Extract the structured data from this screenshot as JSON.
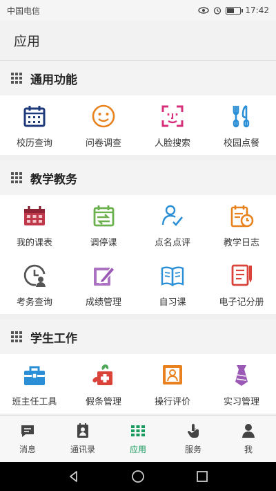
{
  "status_bar": {
    "carrier": "中国电信",
    "time": "17:42",
    "battery_level": 0.55
  },
  "app_bar": {
    "title": "应用"
  },
  "sections": [
    {
      "title": "通用功能",
      "items": [
        {
          "label": "校历查询",
          "icon": "calendar-icon"
        },
        {
          "label": "问卷调查",
          "icon": "smiley-icon"
        },
        {
          "label": "人脸搜索",
          "icon": "face-scan-icon"
        },
        {
          "label": "校园点餐",
          "icon": "fork-knife-icon"
        }
      ]
    },
    {
      "title": "教学教务",
      "items": [
        {
          "label": "我的课表",
          "icon": "timetable-icon"
        },
        {
          "label": "调停课",
          "icon": "calendar-swap-icon"
        },
        {
          "label": "点名点评",
          "icon": "person-check-icon"
        },
        {
          "label": "教学日志",
          "icon": "log-clock-icon"
        },
        {
          "label": "考务查询",
          "icon": "clock-person-icon"
        },
        {
          "label": "成绩管理",
          "icon": "edit-icon"
        },
        {
          "label": "自习课",
          "icon": "book-icon"
        },
        {
          "label": "电子记分册",
          "icon": "scorebook-icon"
        }
      ]
    },
    {
      "title": "学生工作",
      "items": [
        {
          "label": "班主任工具",
          "icon": "toolbox-icon"
        },
        {
          "label": "假条管理",
          "icon": "medical-icon"
        },
        {
          "label": "操行评价",
          "icon": "portrait-icon"
        },
        {
          "label": "实习管理",
          "icon": "tie-icon"
        }
      ]
    }
  ],
  "tabs": [
    {
      "label": "消息",
      "icon": "message-icon",
      "active": false
    },
    {
      "label": "通讯录",
      "icon": "contacts-icon",
      "active": false
    },
    {
      "label": "应用",
      "icon": "apps-grid-icon",
      "active": true
    },
    {
      "label": "服务",
      "icon": "touch-icon",
      "active": false
    },
    {
      "label": "我",
      "icon": "user-icon",
      "active": false
    }
  ],
  "colors": {
    "active_tab": "#1a9a5c",
    "navy": "#1f3a7a",
    "orange": "#e8821e",
    "magenta": "#d6307a",
    "teal": "#2a8fd6",
    "green": "#6ab04c",
    "purple": "#9b59b6",
    "red": "#d9433a"
  }
}
